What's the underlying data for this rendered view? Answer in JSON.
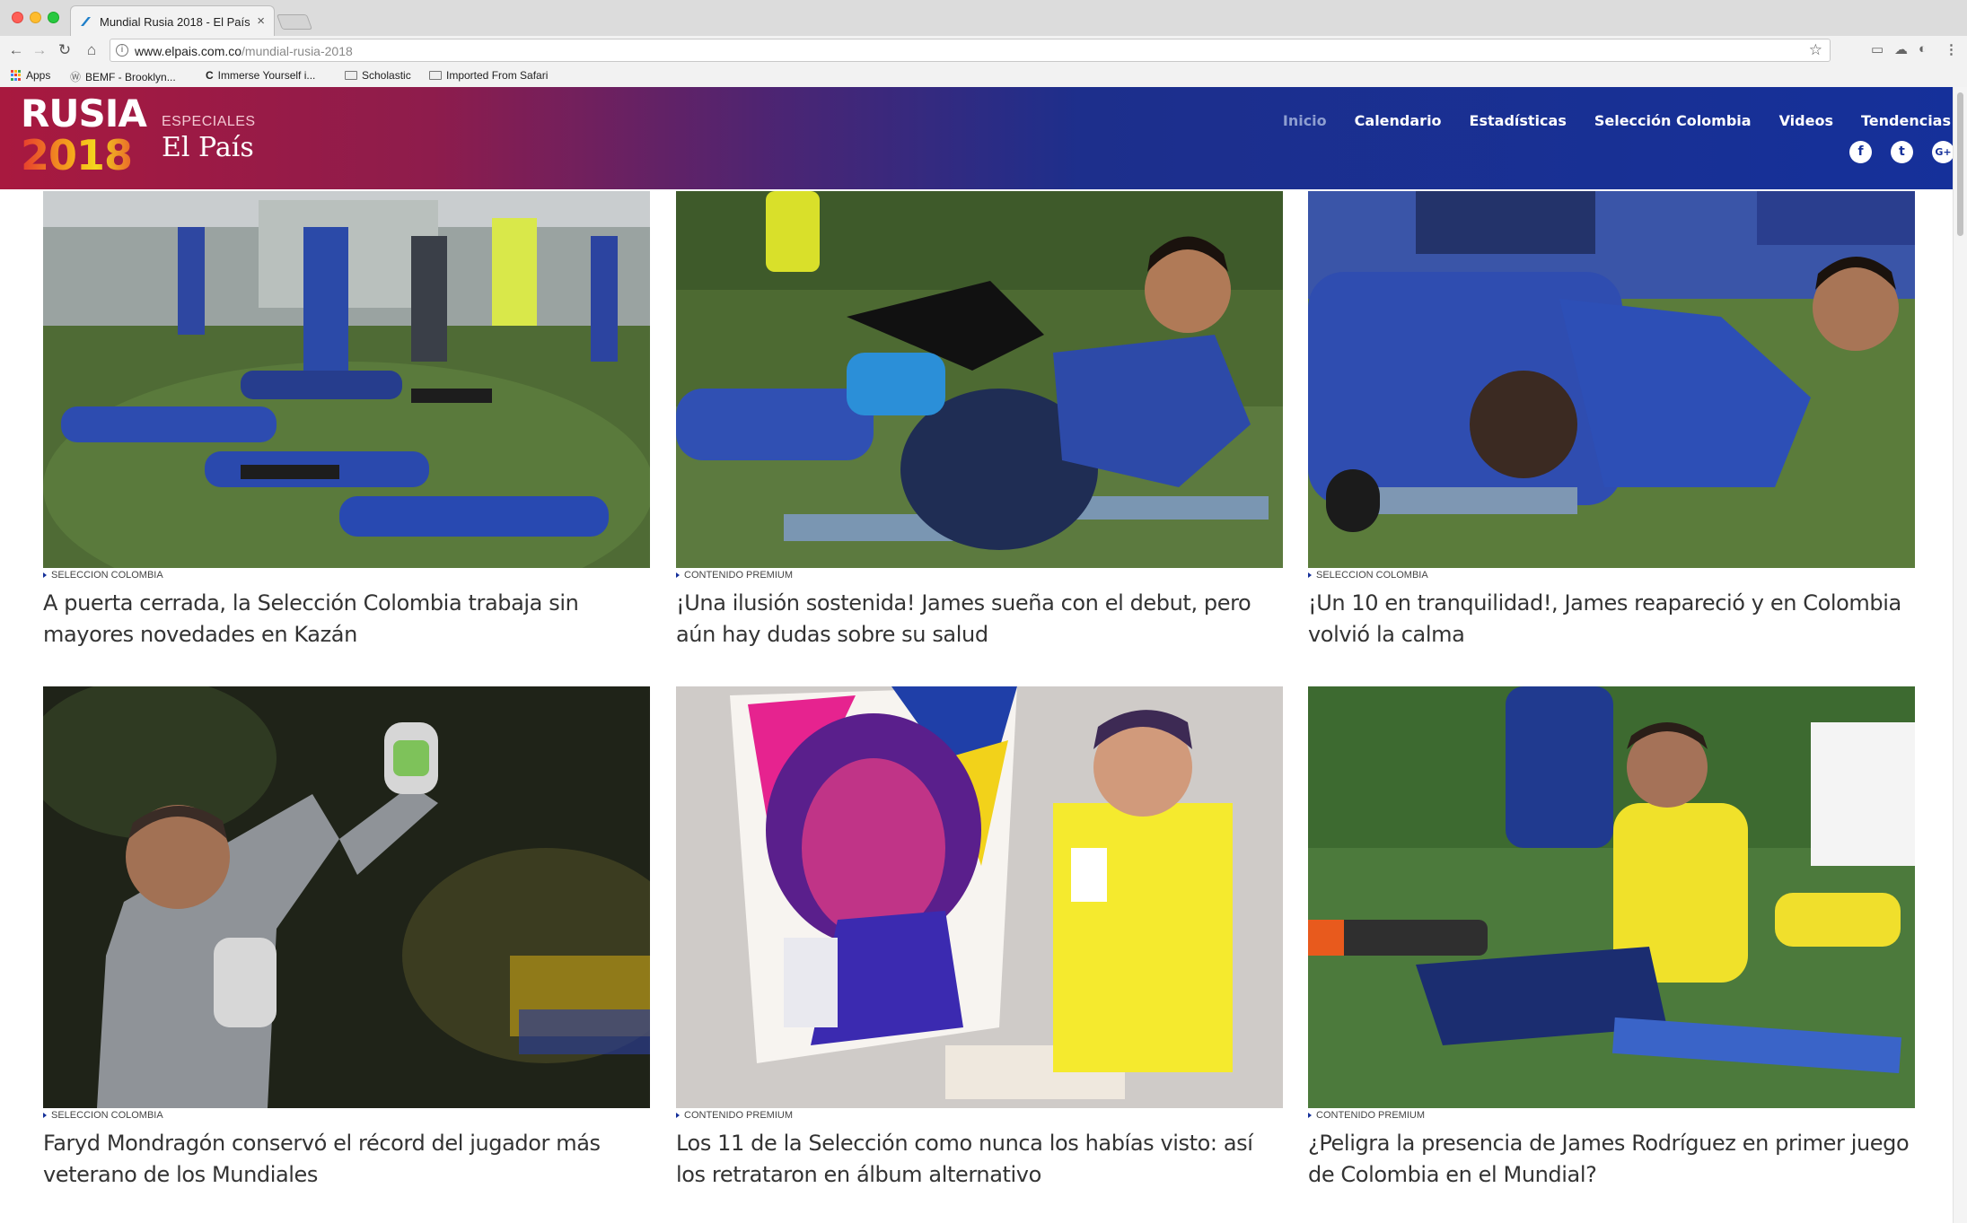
{
  "browser": {
    "tab_title": "Mundial Rusia 2018 - El País",
    "tab_close": "×",
    "url_domain": "www.elpais.com.co",
    "url_path": "/mundial-rusia-2018",
    "bookmarks": [
      {
        "label": "Apps",
        "icon": "apps-grid-icon"
      },
      {
        "label": "BEMF - Brooklyn...",
        "icon": "site-icon"
      },
      {
        "label": "Immerse Yourself i...",
        "icon": "site-icon"
      },
      {
        "label": "Scholastic",
        "icon": "folder-icon"
      },
      {
        "label": "Imported From Safari",
        "icon": "folder-icon"
      }
    ]
  },
  "header": {
    "logo_line1": "RUSIA",
    "logo_line2": "2018",
    "especiales": "ESPECIALES",
    "elpais": "El País",
    "nav": [
      {
        "label": "Inicio",
        "active": true
      },
      {
        "label": "Calendario",
        "active": false
      },
      {
        "label": "Estadísticas",
        "active": false
      },
      {
        "label": "Selección Colombia",
        "active": false
      },
      {
        "label": "Videos",
        "active": false
      },
      {
        "label": "Tendencias",
        "active": false
      }
    ],
    "social": [
      {
        "name": "facebook-icon",
        "glyph": "f"
      },
      {
        "name": "twitter-icon",
        "glyph": "t"
      },
      {
        "name": "google-plus-icon",
        "glyph": "G+"
      }
    ]
  },
  "articles": [
    {
      "category": "SELECCION COLOMBIA",
      "title": "A puerta cerrada, la Selección Colombia trabaja sin mayores novedades en Kazán",
      "photo": "training-team-stretching"
    },
    {
      "category": "CONTENIDO PREMIUM",
      "title": "¡Una ilusión sostenida! James sueña con el debut, pero aún hay dudas sobre su salud",
      "photo": "james-sit-up"
    },
    {
      "category": "SELECCION COLOMBIA",
      "title": "¡Un 10 en tranquilidad!, James reapareció y en Colombia volvió la calma",
      "photo": "james-push-up"
    },
    {
      "category": "SELECCION COLOMBIA",
      "title": "Faryd Mondragón conservó el récord del jugador más veterano de los Mundiales",
      "photo": "goalkeeper-celebrating"
    },
    {
      "category": "CONTENIDO PREMIUM",
      "title": "Los 11 de la Selección como nunca los habías visto: así los retrataron en álbum alternativo",
      "photo": "poster-artwork"
    },
    {
      "category": "CONTENIDO PREMIUM",
      "title": "¿Peligra la presencia de James Rodríguez en primer juego de Colombia en el Mundial?",
      "photo": "james-seated-yellow"
    }
  ],
  "colors": {
    "brand_red": "#a8193f",
    "brand_blue": "#15309a",
    "nav_active": "#8e9ed0"
  }
}
